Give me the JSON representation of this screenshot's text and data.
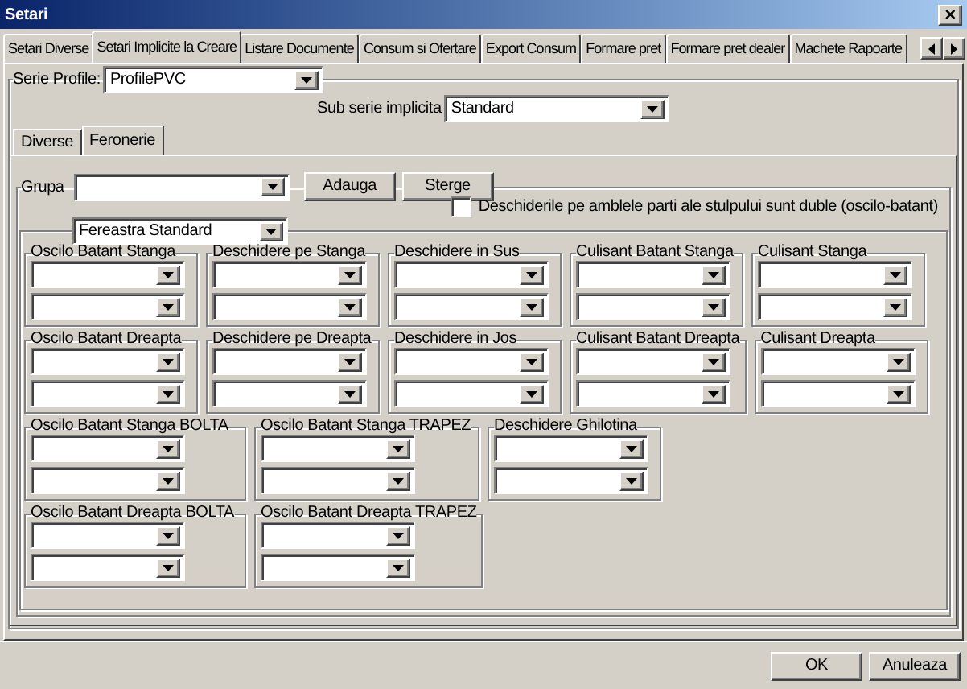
{
  "window": {
    "title": "Setari",
    "close": "×"
  },
  "tabs": [
    {
      "label": "Setari Diverse",
      "selected": false
    },
    {
      "label": "Setari Implicite la Creare",
      "selected": true
    },
    {
      "label": "Listare Documente",
      "selected": false
    },
    {
      "label": "Consum si Ofertare",
      "selected": false
    },
    {
      "label": "Export Consum",
      "selected": false
    },
    {
      "label": "Formare pret",
      "selected": false
    },
    {
      "label": "Formare pret dealer",
      "selected": false
    },
    {
      "label": "Machete Rapoarte",
      "selected": false
    }
  ],
  "serie_profile": {
    "label": "Serie Profile:",
    "value": "ProfilePVC"
  },
  "sub_serie": {
    "label": "Sub serie implicita",
    "value": "Standard"
  },
  "inner_tabs": [
    {
      "label": "Diverse",
      "selected": false
    },
    {
      "label": "Feronerie",
      "selected": true
    }
  ],
  "grupa": {
    "label": "Grupa",
    "buttons": [
      "Adauga",
      "Sterge"
    ]
  },
  "fereastra": {
    "value": "Fereastra Standard"
  },
  "duble_checkbox": {
    "label": "Deschiderile pe amblele parti ale stulpului sunt duble (oscilo-batant)",
    "checked": false
  },
  "group_rows": [
    [
      {
        "title": "Oscilo Batant Stanga"
      },
      {
        "title": "Deschidere pe Stanga"
      },
      {
        "title": "Deschidere in Sus"
      },
      {
        "title": "Culisant Batant Stanga"
      },
      {
        "title": "Culisant Stanga"
      }
    ],
    [
      {
        "title": "Oscilo Batant Dreapta"
      },
      {
        "title": "Deschidere pe Dreapta"
      },
      {
        "title": "Deschidere in Jos"
      },
      {
        "title": "Culisant Batant Dreapta"
      },
      {
        "title": "Culisant Dreapta"
      }
    ],
    [
      {
        "title": "Oscilo Batant Stanga BOLTA"
      },
      {
        "title": "Oscilo Batant Stanga TRAPEZ"
      },
      {
        "title": "Deschidere Ghilotina"
      }
    ],
    [
      {
        "title": "Oscilo Batant Dreapta BOLTA"
      },
      {
        "title": "Oscilo Batant Dreapta TRAPEZ"
      }
    ]
  ],
  "footer_buttons": [
    "OK",
    "Anuleaza"
  ]
}
